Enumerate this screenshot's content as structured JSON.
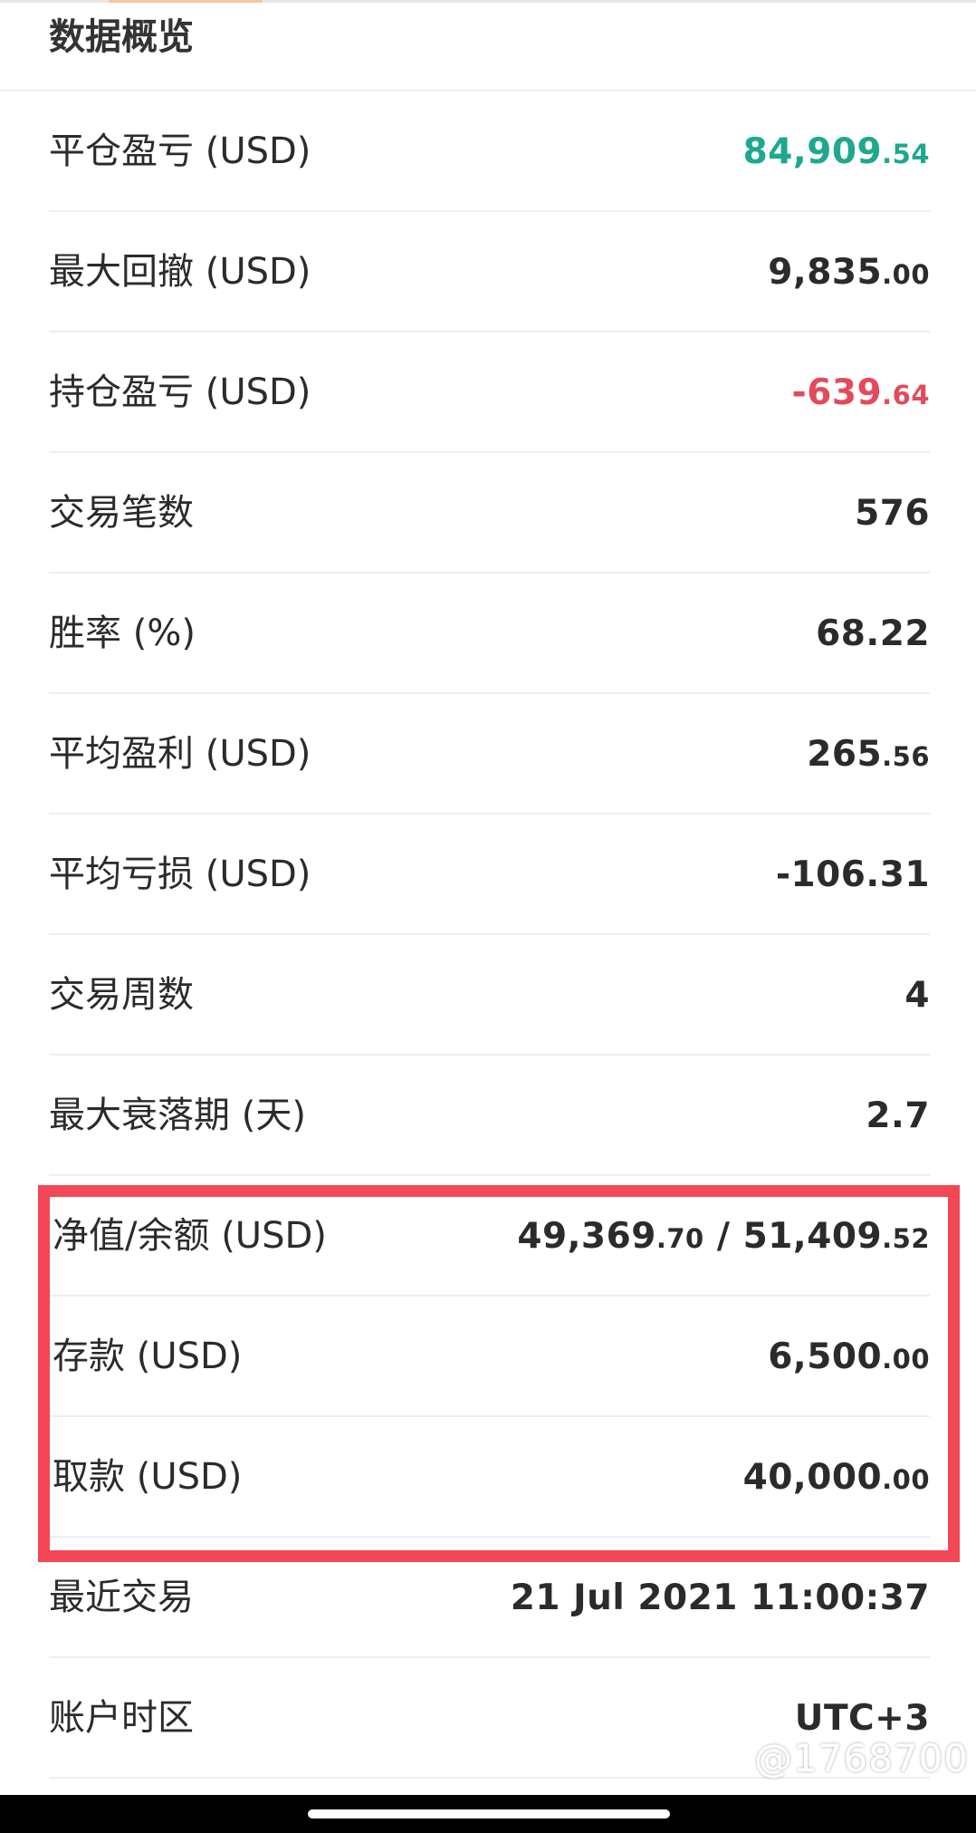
{
  "header": {
    "title": "数据概览"
  },
  "rows": [
    {
      "label": "平仓盈亏 (USD)",
      "int": "84,909",
      "dec": ".54"
    },
    {
      "label": "最大回撤 (USD)",
      "int": "9,835",
      "dec": ".00"
    },
    {
      "label": "持仓盈亏 (USD)",
      "int": "-639",
      "dec": ".64"
    },
    {
      "label": "交易笔数",
      "int": "576",
      "dec": ""
    },
    {
      "label": "胜率 (%)",
      "int": "68.22",
      "dec": ""
    },
    {
      "label": "平均盈利 (USD)",
      "int": "265",
      "dec": ".56"
    },
    {
      "label": "平均亏损 (USD)",
      "int": "-106.31",
      "dec": ""
    },
    {
      "label": "交易周数",
      "int": "4",
      "dec": ""
    },
    {
      "label": "最大衰落期 (天)",
      "int": "2.7",
      "dec": ""
    },
    {
      "label": "净值/余额 (USD)",
      "int": "49,369",
      "dec": ".70",
      "int2": " / 51,409",
      "dec2": ".52"
    },
    {
      "label": "存款 (USD)",
      "int": "6,500",
      "dec": ".00"
    },
    {
      "label": "取款 (USD)",
      "int": "40,000",
      "dec": ".00"
    },
    {
      "label": "最近交易",
      "int": "21 Jul 2021 11:00:37",
      "dec": ""
    },
    {
      "label": "账户时区",
      "int": "UTC+3",
      "dec": ""
    }
  ],
  "colors": {
    "profit": "#1ea88e",
    "loss": "#e34a5a",
    "highlight": "#f34755"
  },
  "watermark": "@1768700"
}
